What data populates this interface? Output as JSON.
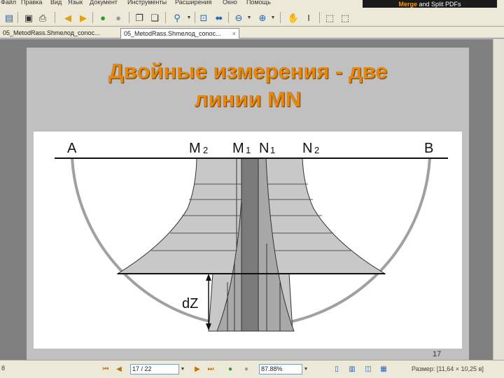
{
  "menu": {
    "items": [
      "Файл",
      "Правка",
      "Вид",
      "Язык",
      "Документ",
      "Инструменты",
      "Расширения",
      "Окно",
      "Помощь"
    ]
  },
  "banner": {
    "highlight": "Merge",
    "rest": " and Split PDFs"
  },
  "tabs": [
    {
      "label": "05_MetodRass.Shmeлод_conoc..."
    },
    {
      "label": "05_MetodRass.Shmeлод_conoc...",
      "close": "×"
    }
  ],
  "slide": {
    "title_line1": "Двойные измерения - две",
    "title_line2": "линии MN",
    "page_number": "17",
    "diagram": {
      "label_a": "A",
      "label_m2": "M",
      "sub_m2": "2",
      "label_m1": "M",
      "sub_m1": "1",
      "label_n1": "N",
      "sub_n1": "1",
      "label_n2": "N",
      "sub_n2": "2",
      "label_b": "B",
      "label_dz": "dZ"
    }
  },
  "statusbar": {
    "left_text": "8",
    "page_field": "17 / 22",
    "zoom_field": "87.88%",
    "size_text": "Размер: [11,64 × 10,25 в]"
  },
  "icons": {
    "accent": "#e8870e"
  }
}
